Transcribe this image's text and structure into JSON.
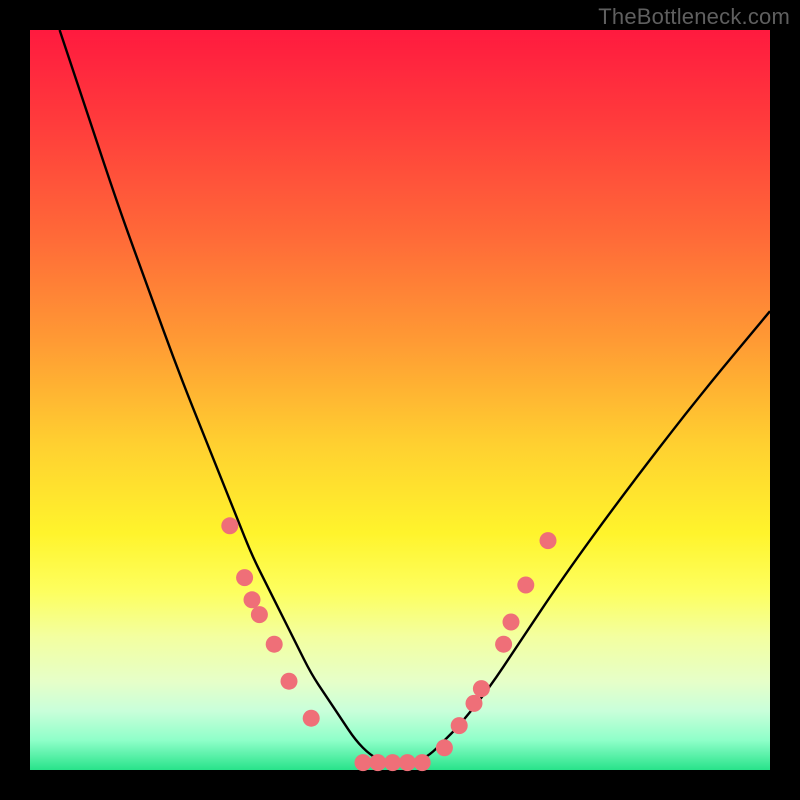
{
  "watermark": "TheBottleneck.com",
  "colors": {
    "frame": "#000000",
    "curve": "#000000",
    "marker": "#ef6f78"
  },
  "chart_data": {
    "type": "line",
    "title": "",
    "xlabel": "",
    "ylabel": "",
    "xlim": [
      0,
      100
    ],
    "ylim": [
      0,
      100
    ],
    "grid": false,
    "legend": false,
    "series": [
      {
        "name": "bottleneck-curve",
        "x": [
          4,
          8,
          12,
          16,
          20,
          24,
          26,
          28,
          30,
          32,
          34,
          36,
          38,
          40,
          42,
          44,
          46,
          48,
          50,
          52,
          54,
          56,
          58,
          62,
          66,
          72,
          80,
          90,
          100
        ],
        "y": [
          100,
          88,
          76,
          65,
          54,
          44,
          39,
          34,
          29,
          25,
          21,
          17,
          13,
          10,
          7,
          4,
          2,
          1,
          1,
          1,
          2,
          4,
          6,
          11,
          17,
          26,
          37,
          50,
          62
        ]
      }
    ],
    "markers": {
      "name": "sample-points",
      "points": [
        {
          "x": 27,
          "y": 33
        },
        {
          "x": 29,
          "y": 26
        },
        {
          "x": 30,
          "y": 23
        },
        {
          "x": 31,
          "y": 21
        },
        {
          "x": 33,
          "y": 17
        },
        {
          "x": 35,
          "y": 12
        },
        {
          "x": 38,
          "y": 7
        },
        {
          "x": 45,
          "y": 1
        },
        {
          "x": 47,
          "y": 1
        },
        {
          "x": 49,
          "y": 1
        },
        {
          "x": 51,
          "y": 1
        },
        {
          "x": 53,
          "y": 1
        },
        {
          "x": 56,
          "y": 3
        },
        {
          "x": 58,
          "y": 6
        },
        {
          "x": 60,
          "y": 9
        },
        {
          "x": 61,
          "y": 11
        },
        {
          "x": 64,
          "y": 17
        },
        {
          "x": 65,
          "y": 20
        },
        {
          "x": 67,
          "y": 25
        },
        {
          "x": 70,
          "y": 31
        }
      ]
    }
  }
}
